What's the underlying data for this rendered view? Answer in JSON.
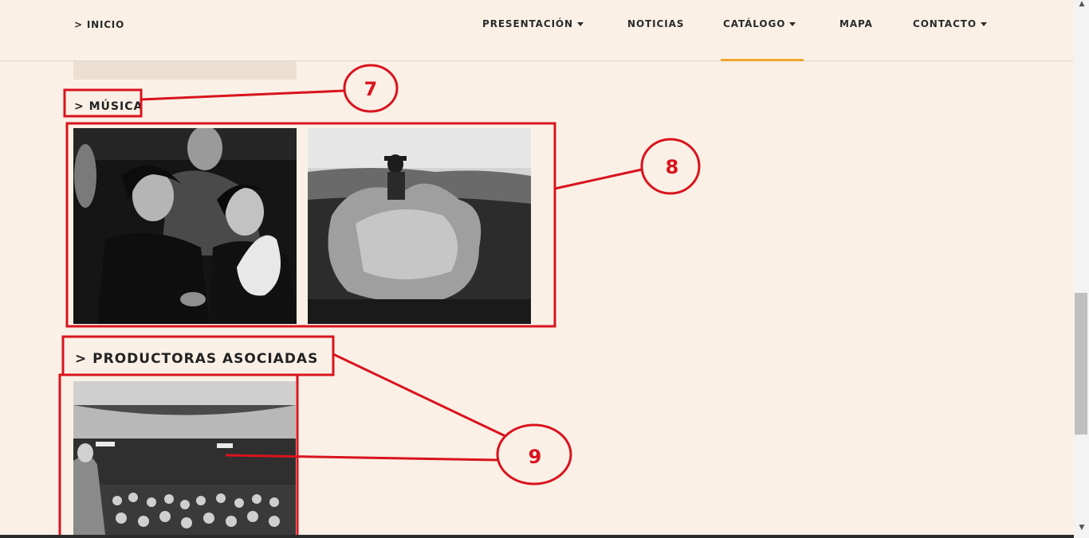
{
  "nav": {
    "home_label": "> INICIO",
    "items": [
      {
        "label": "PRESENTACIÓN",
        "has_dropdown": true
      },
      {
        "label": "NOTICIAS",
        "has_dropdown": false
      },
      {
        "label": "CATÁLOGO",
        "has_dropdown": true,
        "active": true
      },
      {
        "label": "MAPA",
        "has_dropdown": false
      },
      {
        "label": "CONTACTO",
        "has_dropdown": true
      }
    ],
    "active_color": "#f0a531"
  },
  "sections": {
    "musica": {
      "title": "> MÚSICA",
      "images": [
        "black-and-white photo of people gathered, two women in foreground",
        "black-and-white photo of a person carrying hay on a field"
      ]
    },
    "productoras": {
      "title": "> PRODUCTORAS ASOCIADAS",
      "images": [
        "black-and-white photo of an audience in a cinema hall with a man standing"
      ]
    }
  },
  "annotations": {
    "color": "#d9131d",
    "labels": [
      "7",
      "8",
      "9"
    ]
  },
  "colors": {
    "background": "#faf0e6",
    "placeholder": "#ece0d3"
  }
}
